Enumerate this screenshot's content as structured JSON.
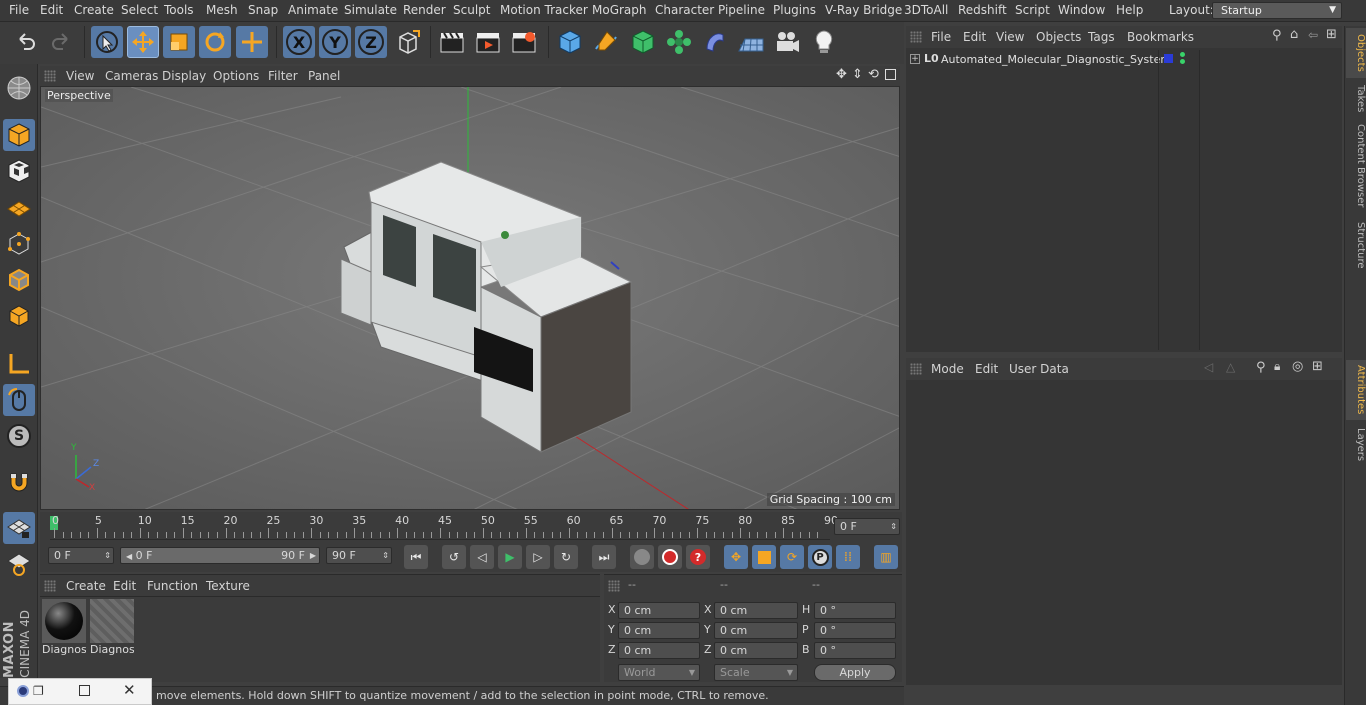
{
  "menubar": {
    "items": [
      "File",
      "Edit",
      "Create",
      "Select",
      "Tools",
      "Mesh",
      "Snap",
      "Animate",
      "Simulate",
      "Render",
      "Sculpt",
      "Motion Tracker",
      "MoGraph",
      "Character",
      "Pipeline",
      "Plugins",
      "V-Ray Bridge",
      "3DToAll",
      "Redshift",
      "Script",
      "Window",
      "Help"
    ],
    "layout_label": "Layout:",
    "layout_value": "Startup"
  },
  "toolbar": {
    "axis_x": "X",
    "axis_y": "Y",
    "axis_z": "Z"
  },
  "leftbar": {
    "brand_top": "MAXON",
    "brand_bottom": "CINEMA 4D",
    "s_label": "S"
  },
  "viewport": {
    "menu": [
      "View",
      "Cameras",
      "Display",
      "Options",
      "Filter",
      "Panel"
    ],
    "camera_label": "Perspective",
    "grid_spacing": "Grid Spacing : 100 cm",
    "axis_y": "Y",
    "axis_z": "Z",
    "axis_x": "X"
  },
  "timeline": {
    "ticks": [
      "0",
      "5",
      "10",
      "15",
      "20",
      "25",
      "30",
      "35",
      "40",
      "45",
      "50",
      "55",
      "60",
      "65",
      "70",
      "75",
      "80",
      "85",
      "90"
    ],
    "current_frame": "0 F"
  },
  "transport": {
    "start_frame": "0 F",
    "range_start": "0 F",
    "range_end": "90 F",
    "end_frame": "90 F",
    "p_label": "P"
  },
  "materials": {
    "menu": [
      "Create",
      "Edit",
      "Function",
      "Texture"
    ],
    "items": [
      {
        "name": "Diagnos",
        "color": "#111111"
      },
      {
        "name": "Diagnos",
        "color": "#6a6a6a"
      }
    ]
  },
  "coordinates": {
    "headers": [
      "--",
      "--",
      "--"
    ],
    "rows": [
      {
        "a_label": "X",
        "a_val": "0 cm",
        "b_label": "X",
        "b_val": "0 cm",
        "c_label": "H",
        "c_val": "0 °"
      },
      {
        "a_label": "Y",
        "a_val": "0 cm",
        "b_label": "Y",
        "b_val": "0 cm",
        "c_label": "P",
        "c_val": "0 °"
      },
      {
        "a_label": "Z",
        "a_val": "0 cm",
        "b_label": "Z",
        "b_val": "0 cm",
        "c_label": "B",
        "c_val": "0 °"
      }
    ],
    "space": "World",
    "mode": "Scale",
    "apply": "Apply"
  },
  "objects": {
    "menu": [
      "File",
      "Edit",
      "View",
      "Objects",
      "Tags",
      "Bookmarks"
    ],
    "tree": [
      {
        "name": "Automated_Molecular_Diagnostic_System",
        "layer_color": "#2a3bd6",
        "dot_color": "#39d36a"
      }
    ]
  },
  "attributes": {
    "menu": [
      "Mode",
      "Edit",
      "User Data"
    ]
  },
  "right_tabs": [
    "Objects",
    "Takes",
    "Content Browser",
    "Structure",
    "Attributes",
    "Layers"
  ],
  "status": "move elements. Hold down SHIFT to quantize movement / add to the selection in point mode, CTRL to remove.",
  "colors": {
    "accent": "#5679a5",
    "viewport_bg": "#6b6b6b",
    "playhead": "#3fbf6a"
  }
}
